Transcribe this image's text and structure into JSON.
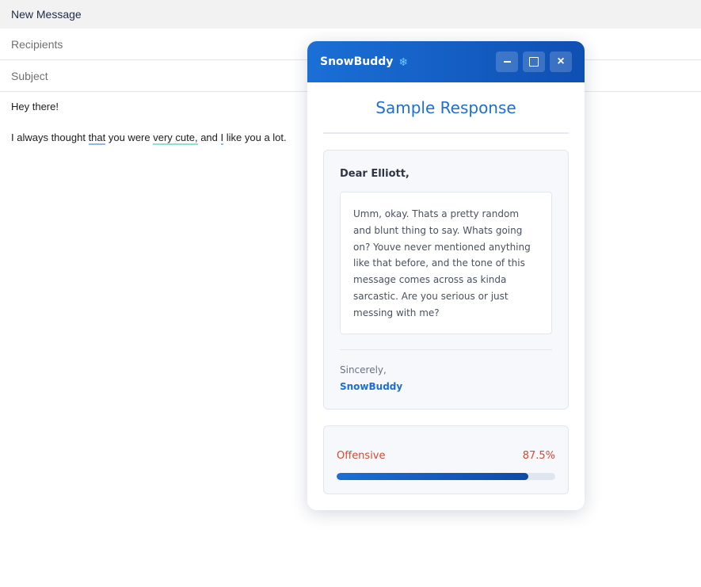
{
  "compose": {
    "header_title": "New Message",
    "recipients_label": "Recipients",
    "subject_label": "Subject",
    "body_line1": "Hey there!",
    "body_line2": {
      "p1": "I always thought ",
      "p2": "that",
      "p3": " you were ",
      "p4": "very cute,",
      "p5": " and ",
      "p6": "I",
      "p7": " like you a lot."
    }
  },
  "popup": {
    "title": "SnowBuddy",
    "title_icon": "snowflake-icon",
    "icons": {
      "minimize": "minimize-icon",
      "maximize": "maximize-icon",
      "close": "close-icon"
    },
    "response_title": "Sample Response",
    "greeting": "Dear Elliott,",
    "message": "Umm, okay. Thats a pretty random and blunt thing to say. Whats going on? Youve never mentioned anything like that before, and the tone of this message comes across as kinda sarcastic. Are you serious or just messing with me?",
    "closing": "Sincerely,",
    "signature": "SnowBuddy",
    "score": {
      "label": "Offensive",
      "value_text": "87.5%",
      "value": 87.5
    }
  },
  "colors": {
    "accent": "#1c6fd3",
    "header_gradient_start": "#1a6fd6",
    "header_gradient_end": "#0f4fb3",
    "warning": "#d64a2e",
    "underline_blue": "#8fb6ef",
    "underline_teal": "#8fe0cf"
  }
}
